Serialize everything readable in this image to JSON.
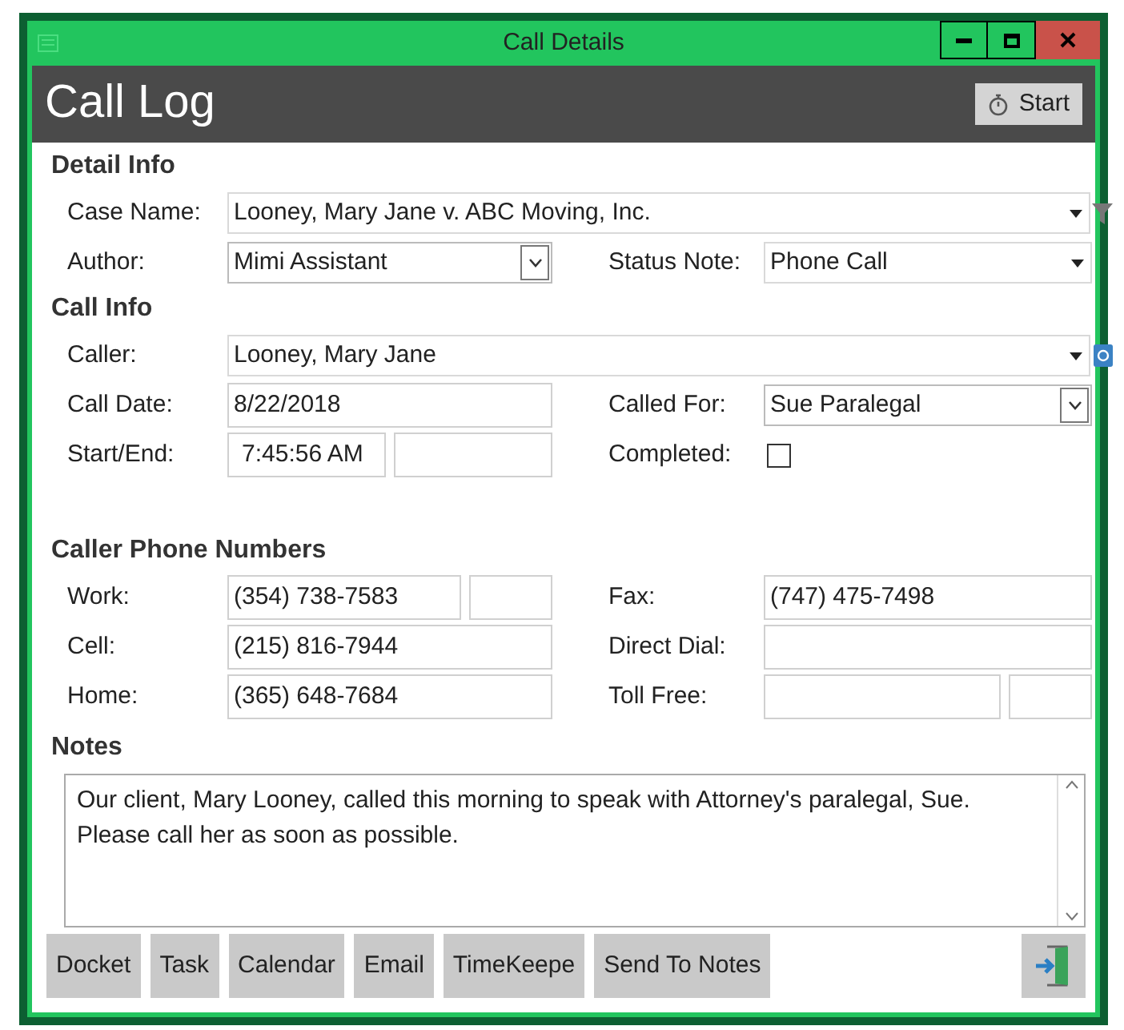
{
  "window": {
    "title": "Call Details"
  },
  "header": {
    "title": "Call Log",
    "start_button": "Start"
  },
  "sections": [
    {
      "heading": "Detail Info",
      "rows": [
        {
          "left": {
            "label": "Case Name:",
            "fields": [
              {
                "kind": "filter-combo",
                "value": "Looney, Mary Jane v. ABC Moving, Inc."
              }
            ]
          }
        },
        {
          "left": {
            "label": "Author:",
            "fields": [
              {
                "kind": "dropdown",
                "value": "Mimi Assistant"
              }
            ]
          },
          "right": {
            "label": "Status Note:",
            "fields": [
              {
                "kind": "combo",
                "value": "Phone Call"
              }
            ]
          }
        }
      ]
    },
    {
      "heading": "Call Info",
      "rows": [
        {
          "left": {
            "label": "Caller:",
            "fields": [
              {
                "kind": "contact-combo",
                "value": "Looney, Mary  Jane"
              }
            ]
          }
        },
        {
          "left": {
            "label": "Call Date:",
            "fields": [
              {
                "kind": "text",
                "value": "8/22/2018"
              }
            ]
          },
          "right": {
            "label": "Called For:",
            "fields": [
              {
                "kind": "dropdown",
                "value": "Sue Paralegal"
              }
            ]
          }
        },
        {
          "left": {
            "label": "Start/End:",
            "fields": [
              {
                "kind": "time",
                "value": "7:45:56 AM"
              },
              {
                "kind": "time"
              }
            ]
          },
          "right": {
            "label": "Completed:",
            "fields": [
              {
                "kind": "checkbox",
                "checked": false
              }
            ]
          }
        }
      ]
    },
    {
      "heading": "Caller Phone Numbers",
      "rows": [
        {
          "left": {
            "label": "Work:",
            "fields": [
              {
                "kind": "text",
                "value": "(354) 738-7583"
              },
              {
                "kind": "ext"
              }
            ]
          },
          "right": {
            "label": "Fax:",
            "fields": [
              {
                "kind": "text",
                "value": "(747) 475-7498"
              }
            ]
          }
        },
        {
          "left": {
            "label": "Cell:",
            "fields": [
              {
                "kind": "text",
                "value": "(215) 816-7944"
              }
            ]
          },
          "right": {
            "label": "Direct Dial:",
            "fields": [
              {
                "kind": "text"
              }
            ]
          }
        },
        {
          "left": {
            "label": "Home:",
            "fields": [
              {
                "kind": "text",
                "value": "(365) 648-7684"
              }
            ]
          },
          "right": {
            "label": "Toll Free:",
            "fields": [
              {
                "kind": "text"
              },
              {
                "kind": "ext"
              }
            ]
          }
        }
      ]
    }
  ],
  "notes": {
    "heading": "Notes",
    "text": "Our client, Mary Looney, called this morning to speak with Attorney's paralegal, Sue. Please call her as soon as possible."
  },
  "buttons": [
    {
      "kind": "text",
      "label": "Docket"
    },
    {
      "kind": "text",
      "label": "Task"
    },
    {
      "kind": "text",
      "label": "Calendar"
    },
    {
      "kind": "text",
      "label": "Email"
    },
    {
      "kind": "text",
      "label": "TimeKeepe"
    },
    {
      "kind": "text",
      "label": "Send To Notes"
    },
    {
      "kind": "exit"
    }
  ]
}
